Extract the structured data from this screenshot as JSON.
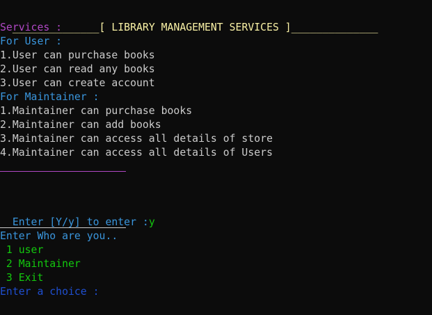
{
  "header": {
    "left_rule": "______________",
    "title": "[ LIBRARY MANAGEMENT SERVICES ]",
    "right_rule": "______________"
  },
  "services": {
    "heading": "Services :",
    "user_heading": "For User :",
    "user_items": [
      "1.User can purchase books",
      "2.User can read any books",
      "3.User can create account"
    ],
    "maintainer_heading": "For Maintainer :",
    "maintainer_items": [
      "1.Maintainer can purchase books",
      "2.Maintainer can add books",
      "3.Maintainer can access all details of store",
      "4.Maintainer can access all details of Users"
    ]
  },
  "prompt_enter": {
    "label": "Enter [Y/y] to enter :",
    "input": "y"
  },
  "role_menu": {
    "heading": "Enter Who are you..",
    "options": [
      " 1 user",
      " 2 Maintainer",
      " 3 Exit"
    ],
    "prompt": "Enter a choice :"
  },
  "colors": {
    "background": "#0c0c0c",
    "header": "#f9f1a5",
    "services_heading": "#b148c6",
    "section_heading": "#3a96dd",
    "body_text": "#cccccc",
    "menu_options": "#13c80e",
    "choice_prompt": "#1f4fd1"
  }
}
